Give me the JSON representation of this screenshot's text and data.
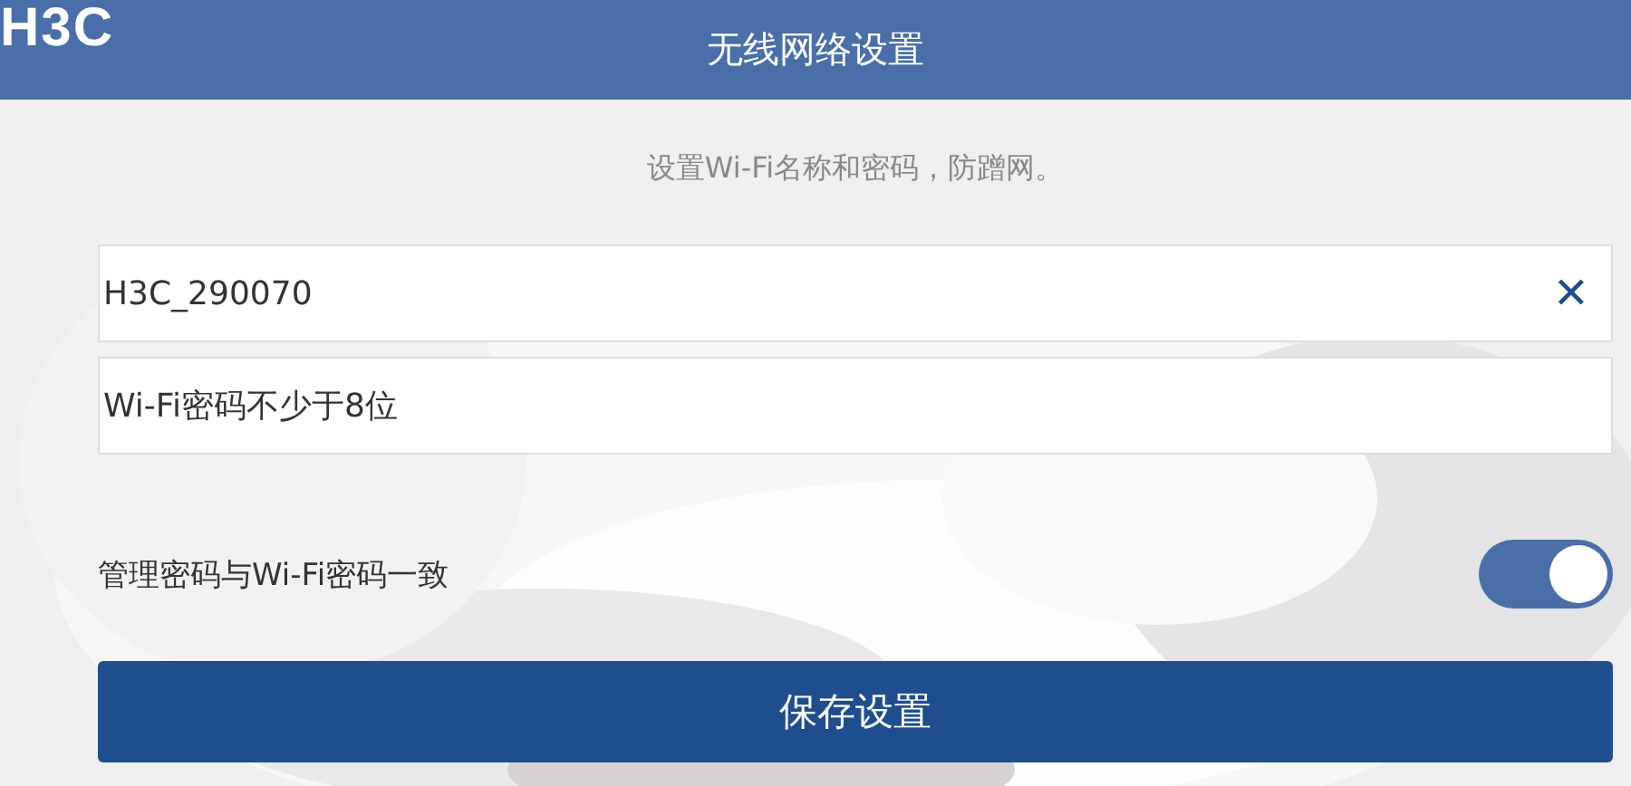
{
  "header": {
    "logo": "H3C",
    "title": "无线网络设置"
  },
  "intro": "设置Wi-Fi名称和密码，防蹭网。",
  "ssid_field": {
    "value": "H3C_290070",
    "clear_icon": "✕"
  },
  "password_field": {
    "placeholder": "Wi-Fi密码不少于8位"
  },
  "sync_toggle": {
    "label": "管理密码与Wi-Fi密码一致",
    "on": true
  },
  "save_button": "保存设置"
}
